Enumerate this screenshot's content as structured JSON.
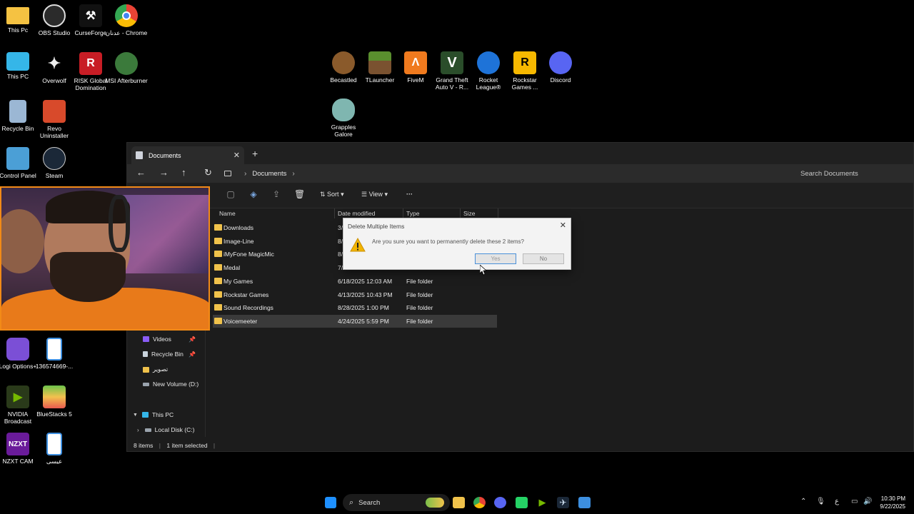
{
  "desktop_icons": [
    {
      "label": "This Pc",
      "icon": "folder-icon",
      "color": "#f5c242"
    },
    {
      "label": "OBS Studio",
      "icon": "obs-icon",
      "color": "#2b2b2b"
    },
    {
      "label": "CurseForge",
      "icon": "curseforge-icon",
      "color": "#111111"
    },
    {
      "label": "عدنان - Chrome",
      "icon": "chrome-icon",
      "color": "#3a8ee6"
    },
    {
      "label": "This PC",
      "icon": "monitor-icon",
      "color": "#35b6e8"
    },
    {
      "label": "Overwolf",
      "icon": "overwolf-icon",
      "color": "#111111"
    },
    {
      "label": "RISK Global Domination",
      "icon": "risk-icon",
      "color": "#c81d25"
    },
    {
      "label": "MSI Afterburner",
      "icon": "msi-icon",
      "color": "#3b7a3b"
    },
    {
      "label": "Recycle Bin",
      "icon": "recycle-bin-icon",
      "color": "#9bb7d4"
    },
    {
      "label": "Revo Uninstaller",
      "icon": "revo-icon",
      "color": "#d84a2b"
    },
    {
      "label": "Control Panel",
      "icon": "control-panel-icon",
      "color": "#4b9fd6"
    },
    {
      "label": "Steam",
      "icon": "steam-icon",
      "color": "#1b2838"
    },
    {
      "label": "Logi Options+",
      "icon": "logi-icon",
      "color": "#7b4fd6"
    },
    {
      "label": "136574669-...",
      "icon": "image-file-icon",
      "color": "#3d8fe0"
    },
    {
      "label": "NVIDIA Broadcast",
      "icon": "nvidia-icon",
      "color": "#2a3a1a"
    },
    {
      "label": "BlueStacks 5",
      "icon": "bluestacks-icon",
      "color": "#6cc24a"
    },
    {
      "label": "NZXT CAM",
      "icon": "nzxt-icon",
      "color": "#6a1b9a"
    },
    {
      "label": "عيسى",
      "icon": "image-file-icon",
      "color": "#3d8fe0"
    },
    {
      "label": "Becastled",
      "icon": "becastled-icon",
      "color": "#8a5a2b"
    },
    {
      "label": "TLauncher",
      "icon": "tlauncher-icon",
      "color": "#5a8f2e"
    },
    {
      "label": "FiveM",
      "icon": "fivem-icon",
      "color": "#f07a1e"
    },
    {
      "label": "Grand Theft Auto V - R...",
      "icon": "gta-icon",
      "color": "#2a4d2a"
    },
    {
      "label": "Rocket League®",
      "icon": "rocket-league-icon",
      "color": "#1e73d8"
    },
    {
      "label": "Rockstar Games ...",
      "icon": "rockstar-icon",
      "color": "#f6b800"
    },
    {
      "label": "Discord",
      "icon": "discord-icon",
      "color": "#5865f2"
    },
    {
      "label": "Grapples Galore",
      "icon": "grapples-icon",
      "color": "#7fb6b0"
    }
  ],
  "explorer": {
    "tab_title": "Documents",
    "breadcrumb": "Documents",
    "search_placeholder": "Search Documents",
    "toolbar": {
      "sort": "Sort",
      "view": "View",
      "more": "···"
    },
    "columns": {
      "name": "Name",
      "date": "Date modified",
      "type": "Type",
      "size": "Size"
    },
    "files": [
      {
        "name": "Downloads",
        "date": "3/",
        "type": ""
      },
      {
        "name": "Image-Line",
        "date": "8/",
        "type": ""
      },
      {
        "name": "iMyFone MagicMic",
        "date": "8/",
        "type": ""
      },
      {
        "name": "Medal",
        "date": "7/",
        "type": ""
      },
      {
        "name": "My Games",
        "date": "6/18/2025 12:03 AM",
        "type": "File folder"
      },
      {
        "name": "Rockstar Games",
        "date": "4/13/2025 10:43 PM",
        "type": "File folder"
      },
      {
        "name": "Sound Recordings",
        "date": "8/28/2025 1:00 PM",
        "type": "File folder"
      },
      {
        "name": "Voicemeeter",
        "date": "4/24/2025 5:59 PM",
        "type": "File folder"
      }
    ],
    "sidebar": [
      {
        "label": "Videos",
        "icon": "videos-icon",
        "color": "#8a5cf6",
        "pinned": true
      },
      {
        "label": "Recycle Bin",
        "icon": "recycle-bin-icon",
        "color": "#c9d3dd",
        "pinned": true
      },
      {
        "label": "تصوير",
        "icon": "folder-icon",
        "color": "#f0c24b",
        "pinned": false
      },
      {
        "label": "New Volume (D:)",
        "icon": "drive-icon",
        "color": "#9aa3ad",
        "pinned": false
      },
      {
        "label": "This PC",
        "icon": "this-pc-icon",
        "color": "#35b6e8",
        "pinned": false
      },
      {
        "label": "Local Disk (C:)",
        "icon": "drive-icon",
        "color": "#9aa3ad",
        "pinned": false
      }
    ],
    "status": {
      "count": "8 items",
      "selected": "1 item selected"
    }
  },
  "dialog": {
    "title": "Delete Multiple Items",
    "message": "Are you sure you want to permanently delete these 2 items?",
    "yes": "Yes",
    "no": "No"
  },
  "taskbar": {
    "search": "Search",
    "lang": "ع",
    "time": "10:30 PM",
    "date": "9/22/2025",
    "apps": [
      {
        "icon": "start-icon",
        "color": "#1e90ff"
      },
      {
        "icon": "widgets-icon",
        "color": "#7bbf4a"
      },
      {
        "icon": "file-explorer-icon",
        "color": "#f0c24b"
      },
      {
        "icon": "chrome-icon",
        "color": "#3a8ee6"
      },
      {
        "icon": "discord-icon",
        "color": "#5865f2"
      },
      {
        "icon": "whatsapp-icon",
        "color": "#25d366"
      },
      {
        "icon": "nvidia-icon",
        "color": "#76b900"
      },
      {
        "icon": "steam-icon",
        "color": "#1b2838"
      },
      {
        "icon": "image-viewer-icon",
        "color": "#3d8fe0"
      }
    ]
  }
}
